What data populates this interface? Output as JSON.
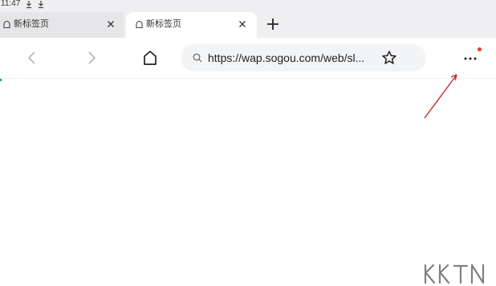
{
  "status_bar": {
    "time": "11:47",
    "icons": [
      "download-icon",
      "download-icon"
    ]
  },
  "tabs": [
    {
      "label": "新标签页",
      "active": false,
      "icon": "tab-page-icon",
      "close_icon": "close-icon"
    },
    {
      "label": "新标签页",
      "active": true,
      "icon": "tab-page-icon",
      "close_icon": "close-icon"
    }
  ],
  "new_tab_icon": "plus-icon",
  "toolbar": {
    "back_icon": "chevron-left-icon",
    "forward_icon": "chevron-right-icon",
    "home_icon": "home-icon",
    "address": {
      "search_icon": "search-icon",
      "url": "https://wap.sogou.com/web/sl..."
    },
    "bookmark_icon": "star-icon",
    "menu_icon": "more-dots-icon",
    "notification_dot_color": "#e53935"
  },
  "annotation": {
    "arrow_color": "#c62828"
  },
  "colors": {
    "tab_strip_bg": "#efeff1",
    "active_tab_bg": "#ffffff",
    "address_bar_bg": "#f3f4f6",
    "disabled_nav": "#b5b5b5"
  }
}
